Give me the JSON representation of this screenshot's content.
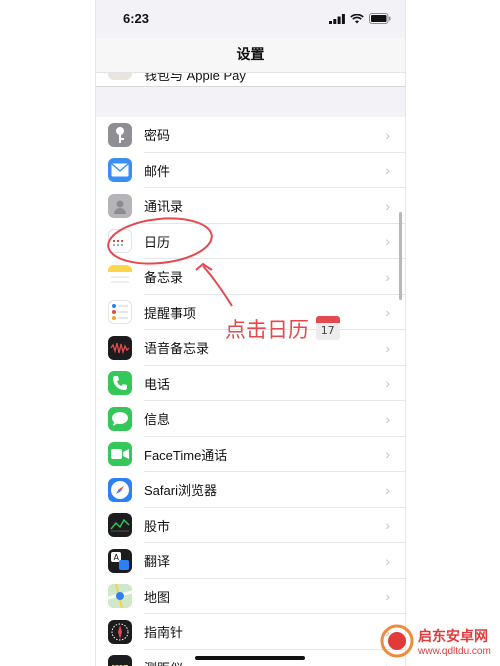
{
  "status_bar": {
    "time": "6:23"
  },
  "nav": {
    "title": "设置"
  },
  "partial_row": {
    "label": "钱包与 Apple Pay"
  },
  "rows": [
    {
      "label": "密码",
      "icon": "key-icon",
      "color": "#8e8e93"
    },
    {
      "label": "邮件",
      "icon": "mail-icon",
      "color": "#3a8ef6"
    },
    {
      "label": "通讯录",
      "icon": "contacts-icon",
      "color": "#b5b5b9"
    },
    {
      "label": "日历",
      "icon": "calendar-icon",
      "color": "#ffffff"
    },
    {
      "label": "备忘录",
      "icon": "notes-icon",
      "color": "#ffd54a"
    },
    {
      "label": "提醒事项",
      "icon": "reminders-icon",
      "color": "#ffffff"
    },
    {
      "label": "语音备忘录",
      "icon": "voice-memos-icon",
      "color": "#1c1c1e"
    },
    {
      "label": "电话",
      "icon": "phone-icon",
      "color": "#34c759"
    },
    {
      "label": "信息",
      "icon": "messages-icon",
      "color": "#34c759"
    },
    {
      "label": "FaceTime通话",
      "icon": "facetime-icon",
      "color": "#34c759"
    },
    {
      "label": "Safari浏览器",
      "icon": "safari-icon",
      "color": "#2c7ff5"
    },
    {
      "label": "股市",
      "icon": "stocks-icon",
      "color": "#1c1c1e"
    },
    {
      "label": "翻译",
      "icon": "translate-icon",
      "color": "#1c1c1e"
    },
    {
      "label": "地图",
      "icon": "maps-icon",
      "color": "#7fc97a"
    },
    {
      "label": "指南针",
      "icon": "compass-icon",
      "color": "#1c1c1e"
    },
    {
      "label": "测距仪",
      "icon": "measure-icon",
      "color": "#1c1c1e"
    }
  ],
  "annotation": {
    "text": "点击日历",
    "calendar_day": "17"
  },
  "watermark": {
    "name": "启东安卓网",
    "url": "www.qdltdu.com"
  },
  "colors": {
    "annotation_red": "#e34a4f",
    "chevron": "#c4c4c7"
  }
}
